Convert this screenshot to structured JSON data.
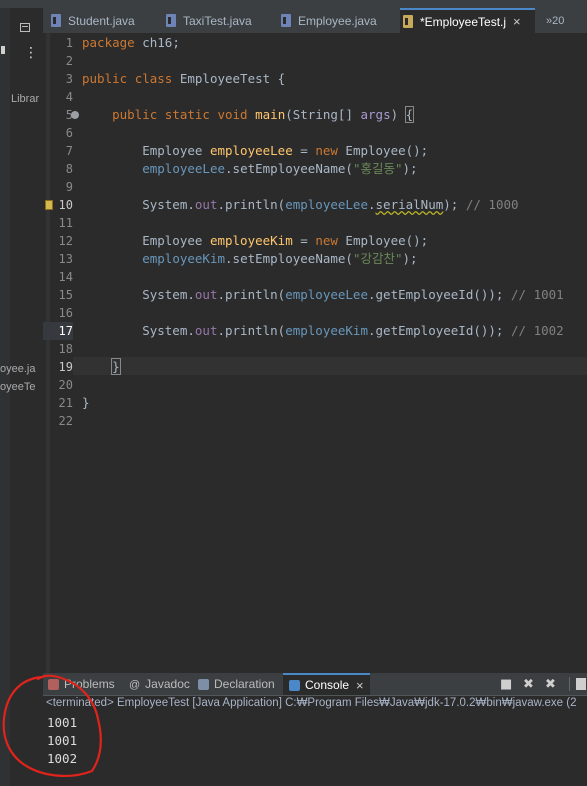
{
  "left_pane": {
    "menu_glyph": "⋮",
    "lib_label": "Librar",
    "item1": "oyee.ja",
    "item2": "oyeeTe"
  },
  "tabs": [
    {
      "label": "Student.java",
      "active": false
    },
    {
      "label": "TaxiTest.java",
      "active": false
    },
    {
      "label": "Employee.java",
      "active": false
    },
    {
      "label": "*EmployeeTest.j",
      "active": true,
      "close": "×"
    }
  ],
  "overflow_tabs": "»20",
  "lines": [
    {
      "n": "1",
      "segs": [
        [
          "kw",
          "package"
        ],
        [
          "t",
          " ch16;"
        ]
      ]
    },
    {
      "n": "2",
      "segs": []
    },
    {
      "n": "3",
      "segs": [
        [
          "kw",
          "public"
        ],
        [
          "t",
          " "
        ],
        [
          "kw",
          "class"
        ],
        [
          "t",
          " EmployeeTest {"
        ]
      ]
    },
    {
      "n": "4",
      "segs": []
    },
    {
      "n": "5",
      "segs": [
        [
          "t",
          "    "
        ],
        [
          "kw",
          "public"
        ],
        [
          "t",
          " "
        ],
        [
          "kw",
          "static"
        ],
        [
          "t",
          " "
        ],
        [
          "kw",
          "void"
        ],
        [
          "t",
          " "
        ],
        [
          "fn",
          "main"
        ],
        [
          "t",
          "(String[] "
        ],
        [
          "param",
          "args"
        ],
        [
          "t",
          ") "
        ],
        [
          "brace",
          "{"
        ]
      ]
    },
    {
      "n": "6",
      "segs": []
    },
    {
      "n": "7",
      "segs": [
        [
          "t",
          "        Employee "
        ],
        [
          "fn",
          "employeeLee"
        ],
        [
          "t",
          " = "
        ],
        [
          "kw",
          "new"
        ],
        [
          "t",
          " Employee();"
        ]
      ]
    },
    {
      "n": "8",
      "segs": [
        [
          "t",
          "        "
        ],
        [
          "local",
          "employeeLee"
        ],
        [
          "t",
          ".setEmployeeName("
        ],
        [
          "str",
          "\"홍길동\""
        ],
        [
          "t",
          ");"
        ]
      ]
    },
    {
      "n": "9",
      "segs": []
    },
    {
      "n": "10",
      "segs": [
        [
          "t",
          "        System."
        ],
        [
          "field",
          "out"
        ],
        [
          "t",
          ".println("
        ],
        [
          "local",
          "employeeLee"
        ],
        [
          "t",
          "."
        ],
        [
          "warn",
          "serialNum"
        ],
        [
          "t",
          "); "
        ],
        [
          "cmt",
          "// 1000"
        ]
      ]
    },
    {
      "n": "11",
      "segs": []
    },
    {
      "n": "12",
      "segs": [
        [
          "t",
          "        Employee "
        ],
        [
          "fn",
          "employeeKim"
        ],
        [
          "t",
          " = "
        ],
        [
          "kw",
          "new"
        ],
        [
          "t",
          " Employee();"
        ]
      ]
    },
    {
      "n": "13",
      "segs": [
        [
          "t",
          "        "
        ],
        [
          "local",
          "employeeKim"
        ],
        [
          "t",
          ".setEmployeeName("
        ],
        [
          "str",
          "\"강감찬\""
        ],
        [
          "t",
          ");"
        ]
      ]
    },
    {
      "n": "14",
      "segs": []
    },
    {
      "n": "15",
      "segs": [
        [
          "t",
          "        System."
        ],
        [
          "field",
          "out"
        ],
        [
          "t",
          ".println("
        ],
        [
          "local",
          "employeeLee"
        ],
        [
          "t",
          ".getEmployeeId()); "
        ],
        [
          "cmt",
          "// 1001"
        ]
      ]
    },
    {
      "n": "16",
      "segs": []
    },
    {
      "n": "17",
      "segs": [
        [
          "t",
          "        System."
        ],
        [
          "field",
          "out"
        ],
        [
          "t",
          ".println("
        ],
        [
          "local",
          "employeeKim"
        ],
        [
          "t",
          ".getEmployeeId()); "
        ],
        [
          "cmt",
          "// 1002"
        ]
      ]
    },
    {
      "n": "18",
      "segs": []
    },
    {
      "n": "19",
      "segs": [
        [
          "t",
          "    "
        ],
        [
          "brace",
          "}"
        ],
        [
          "cursor",
          ""
        ]
      ]
    },
    {
      "n": "20",
      "segs": []
    },
    {
      "n": "21",
      "segs": [
        [
          "t",
          "}"
        ]
      ]
    },
    {
      "n": "22",
      "segs": []
    }
  ],
  "panel": {
    "tabs": [
      {
        "label": "Problems"
      },
      {
        "label": "Javadoc"
      },
      {
        "label": "Declaration"
      },
      {
        "label": "Console",
        "active": true,
        "close": "×"
      }
    ],
    "toolbar": {
      "stop": "■",
      "remove": "✖",
      "remove_all": "✖"
    },
    "terminated": "<terminated> EmployeeTest [Java Application] C:₩Program Files₩Java₩jdk-17.0.2₩bin₩javaw.exe  (2",
    "output": [
      "1001",
      "1001",
      "1002"
    ]
  },
  "colors": {
    "keyword": "#cc7832",
    "method": "#ffc66d",
    "string": "#6a8759",
    "comment": "#808080",
    "annotation_circle": "#e0241b",
    "editor_bg": "#2b2b2b"
  }
}
